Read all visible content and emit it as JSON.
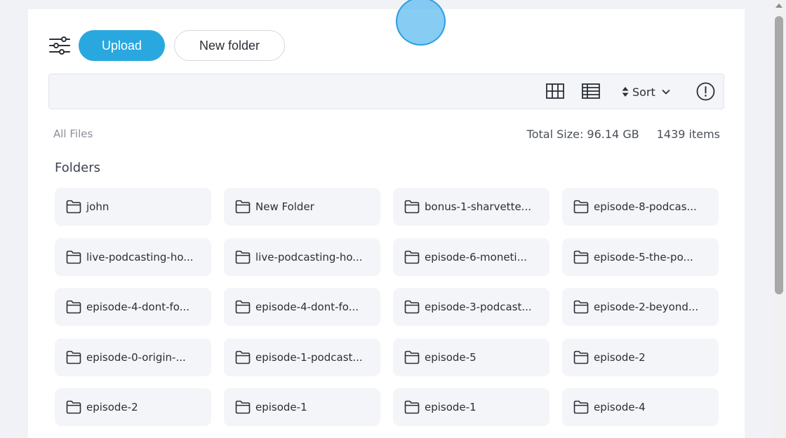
{
  "toolbar": {
    "filter_icon": "sliders-icon",
    "upload_label": "Upload",
    "new_folder_label": "New folder"
  },
  "view_controls": {
    "grid_icon": "grid-view-icon",
    "list_icon": "list-view-icon",
    "sort_label": "Sort",
    "info_icon": "info-icon"
  },
  "breadcrumb": "All Files",
  "stats": {
    "total_size": "Total Size: 96.14 GB",
    "item_count": "1439 items"
  },
  "section_title": "Folders",
  "folders": [
    "john",
    "New Folder",
    "bonus-1-sharvette...",
    "episode-8-podcas...",
    "live-podcasting-ho...",
    "live-podcasting-ho...",
    "episode-6-moneti...",
    "episode-5-the-po...",
    "episode-4-dont-fo...",
    "episode-4-dont-fo...",
    "episode-3-podcast...",
    "episode-2-beyond...",
    "episode-0-origin-...",
    "episode-1-podcast...",
    "episode-5",
    "episode-2",
    "episode-2",
    "episode-1",
    "episode-1",
    "episode-4"
  ],
  "colors": {
    "accent": "#29a8df",
    "background": "#f0f2f5",
    "tile": "#f3f5f8"
  }
}
